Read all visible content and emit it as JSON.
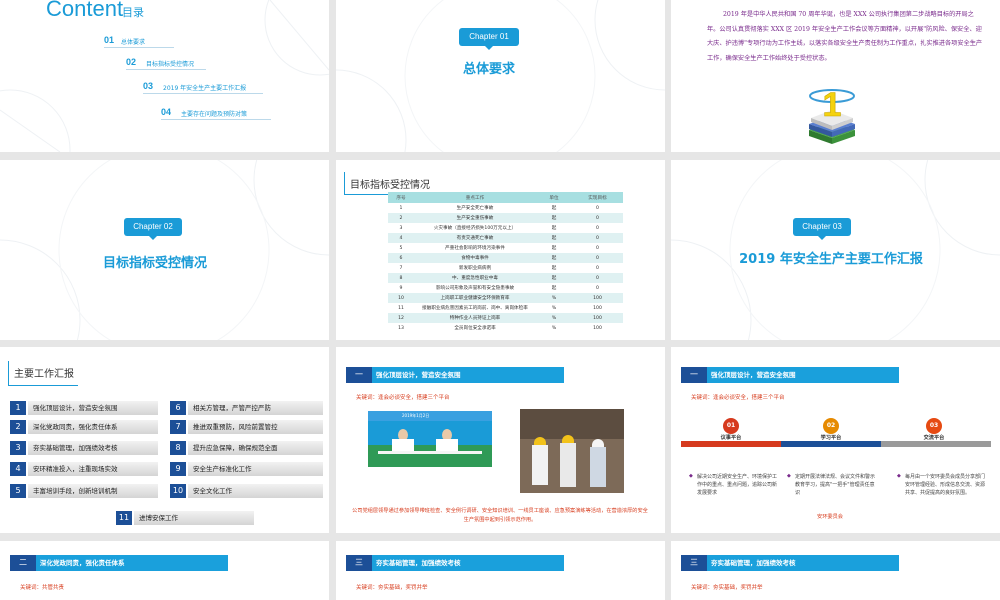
{
  "slides": {
    "s1": {
      "title": "Content",
      "subtitle": "目录",
      "items": [
        {
          "num": "01",
          "text": "总体要求"
        },
        {
          "num": "02",
          "text": "目标指标受控情况"
        },
        {
          "num": "03",
          "text": "2019 年安全生产主要工作汇报"
        },
        {
          "num": "04",
          "text": "主要存在问题及预防对策"
        }
      ]
    },
    "s2": {
      "badge": "Chapter 01",
      "title": "总体要求"
    },
    "s3": {
      "paragraph": "2019 年是中华人民共和国 70 周年华诞，也是 XXX 公司执行集团第二步战略目标的开局之年。公司认真贯彻落实 XXX 区 2019 年安全生产工作会议等方面精神，以开展\"防风险、保安全、迎大庆、护违博\"专项行动为工作主线，以落实各级安全生产责任制为工作重点，扎实推进各项安全生产工作，确保安全生产工作始终处于受控状态。",
      "icon_number": "1"
    },
    "s4": {
      "badge": "Chapter 02",
      "title": "目标指标受控情况"
    },
    "s5": {
      "title": "目标指标受控情况",
      "columns": [
        "序号",
        "重点工作",
        "单位",
        "实现目标"
      ],
      "rows": [
        [
          "1",
          "生产安全死亡事故",
          "起",
          "0"
        ],
        [
          "2",
          "生产安全重伤事故",
          "起",
          "0"
        ],
        [
          "3",
          "火灾事故（直接经济损失100万元以上）",
          "起",
          "0"
        ],
        [
          "4",
          "有责交通死亡事故",
          "起",
          "0"
        ],
        [
          "5",
          "严重社会影响的环境污染事件",
          "起",
          "0"
        ],
        [
          "6",
          "食物中毒事件",
          "起",
          "0"
        ],
        [
          "7",
          "新发职业病病例",
          "起",
          "0"
        ],
        [
          "8",
          "中、重度急性职业中毒",
          "起",
          "0"
        ],
        [
          "9",
          "影响公司形象及声誉和有安全隐患事故",
          "起",
          "0"
        ],
        [
          "10",
          "上岗职工职业健康安全环保教育率",
          "%",
          "100"
        ],
        [
          "11",
          "接触职业病危害因素员工的岗前、岗中、离岗体检率",
          "%",
          "100"
        ],
        [
          "12",
          "特种作业人员持证上岗率",
          "%",
          "100"
        ],
        [
          "13",
          "全员岗位安全承诺率",
          "%",
          "100"
        ]
      ]
    },
    "s6": {
      "badge": "Chapter 03",
      "title": "2019 年安全生产主要工作汇报"
    },
    "s7": {
      "title": "主要工作汇报",
      "items": [
        {
          "num": "1",
          "text": "强化顶层设计，营造安全氛围"
        },
        {
          "num": "2",
          "text": "深化党政同责，强化责任体系"
        },
        {
          "num": "3",
          "text": "夯实基础管理，加强绩效考核"
        },
        {
          "num": "4",
          "text": "安环精准投入，注重现场实效"
        },
        {
          "num": "5",
          "text": "丰富培训手段，创新培训机制"
        },
        {
          "num": "6",
          "text": "相关方管理，严管严控严防"
        },
        {
          "num": "7",
          "text": "推进双重预防，风险前置管控"
        },
        {
          "num": "8",
          "text": "提升应急保障，确保规范全面"
        },
        {
          "num": "9",
          "text": "安全生产标准化工作"
        },
        {
          "num": "10",
          "text": "安全文化工作"
        },
        {
          "num": "11",
          "text": "进博安保工作"
        }
      ]
    },
    "s8": {
      "header_num": "一",
      "header": "强化顶层设计，营造安全氛围",
      "keywords": "关键词：逢会必谈安全，搭建三个平台",
      "photo_caption": "2019年1月2日",
      "body": "公司党组层领导通过参加领导带班检查、安全例行调研、安全知识培训、一线员工座谈、应急预案演练等活动，在营造浓厚的安全生产氛围中起到引领示范作用。"
    },
    "s9": {
      "header_num": "一",
      "header": "强化顶层设计，营造安全氛围",
      "keywords": "关键词：逢会必谈安全，搭建三个平台",
      "platforms": [
        {
          "num": "01",
          "label": "议事平台",
          "color": "#d63a1e",
          "text": "解决公司近期安全生产、环境保护工作中的重点、重点问题，追踪公司新发展要求"
        },
        {
          "num": "02",
          "label": "学习平台",
          "color": "#e68a00",
          "text": "定期开展法律法规、会议文件和警示教育学习，提高\"一把手\"管理责任意识"
        },
        {
          "num": "03",
          "label": "交流平台",
          "color": "#e64a12",
          "text": "每月由一个安环委员会成员分享部门安环管理经验、形成信息交流、资源共享、共促提高的良好氛围。"
        }
      ],
      "footer": "安环委员会"
    },
    "s10": {
      "header_num": "二",
      "header": "深化党政同责，强化责任体系",
      "keywords": "关键词：共管共责"
    },
    "s11": {
      "header_num": "三",
      "header": "夯实基础管理，加强绩效考核",
      "keywords": "关键词：夯实基础，奖罚并举"
    },
    "s12": {
      "header_num": "三",
      "header": "夯实基础管理，加强绩效考核",
      "keywords": "关键词：夯实基础，奖罚并举"
    }
  },
  "colors": {
    "accent": "#1a9bd7",
    "navy": "#1c4f97",
    "red": "#d73c1d"
  }
}
